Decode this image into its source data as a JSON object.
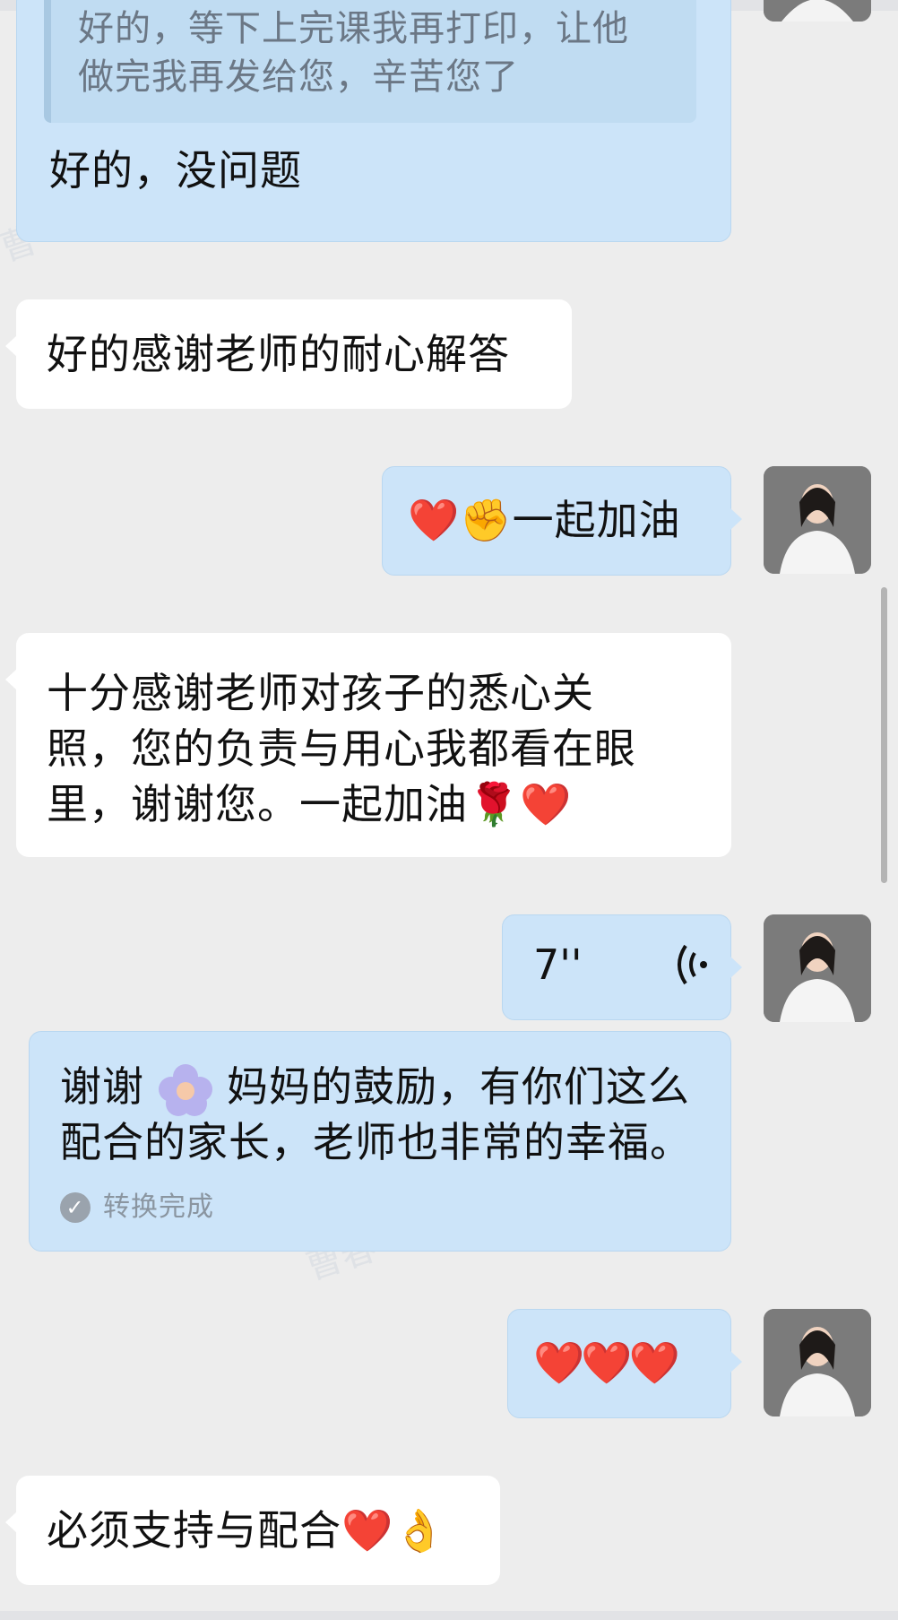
{
  "messages": {
    "m1": {
      "quote_line1": "好的，等下上完课我再打印，让他",
      "quote_line2": "做完我再发给您，辛苦您了",
      "text": "好的，没问题"
    },
    "m2": {
      "text": "好的感谢老师的耐心解答"
    },
    "m3": {
      "emoji_heart": "❤️",
      "emoji_fist": "✊",
      "text": "一起加油"
    },
    "m4": {
      "line1": "十分感谢老师对孩子的悉心关",
      "line2": "照，您的负责与用心我都看在眼",
      "line3": "里，谢谢您。一起加油",
      "emoji_rose": "🌹",
      "emoji_heart": "❤️"
    },
    "m5": {
      "duration": "7''",
      "voice_icon": "voice-wave-icon"
    },
    "m6": {
      "line1_a": "谢谢",
      "line1_b": "妈妈的鼓励，有你们这么",
      "line2": "配合的家长，老师也非常的幸福。",
      "status": "转换完成"
    },
    "m7": {
      "emoji": "❤️❤️❤️"
    },
    "m8": {
      "text": "必须支持与配合",
      "emoji_heart": "❤️",
      "emoji_hand": "👌"
    }
  },
  "colors": {
    "background": "#ededed",
    "incoming_bubble": "#ffffff",
    "outgoing_bubble": "#cce4f9",
    "quote_text": "#6b7785"
  }
}
